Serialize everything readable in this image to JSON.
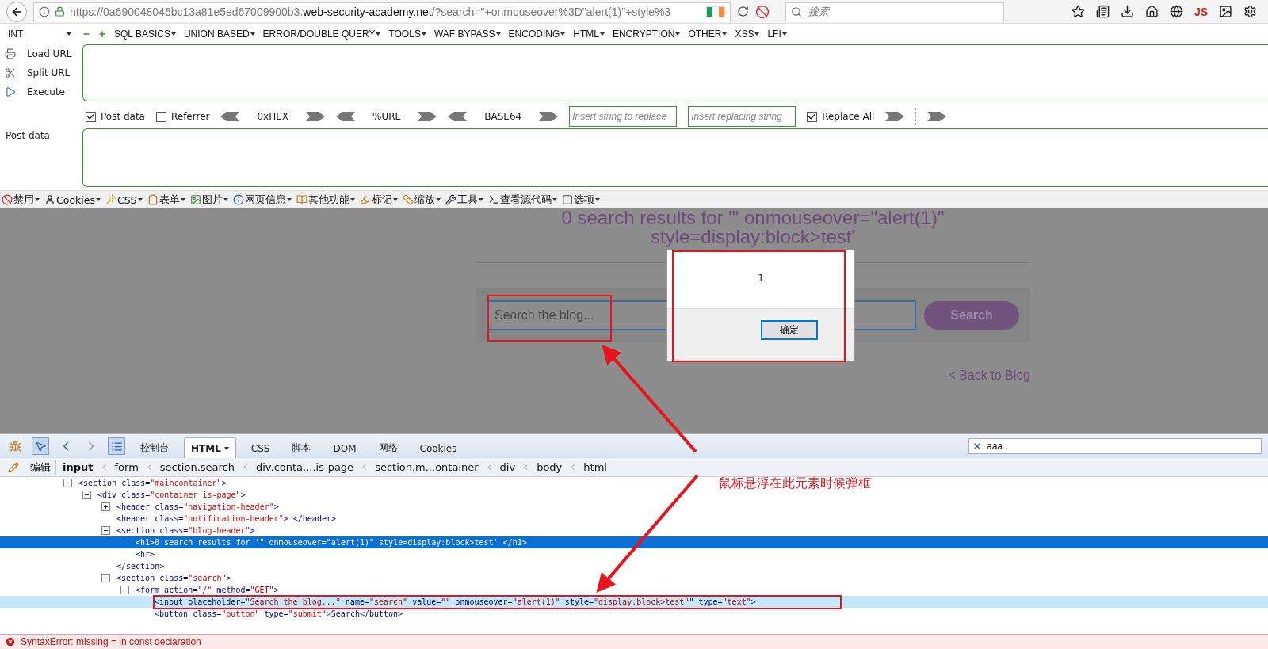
{
  "browser": {
    "url": {
      "prefix": "https://0a690048046bc13a81e5ed67009900b3.",
      "domain": "web-security-academy.net",
      "path": "/?search=\"+onmouseover%3D\"alert(1)\"+style%3"
    },
    "search": {
      "placeholder": "搜索"
    },
    "js_label": "JS"
  },
  "hackbar": {
    "select": "INT",
    "menus": [
      "SQL BASICS",
      "UNION BASED",
      "ERROR/DOUBLE QUERY",
      "TOOLS",
      "WAF BYPASS",
      "ENCODING",
      "HTML",
      "ENCRYPTION",
      "OTHER",
      "XSS",
      "LFI"
    ],
    "actions": [
      {
        "label": "Load URL",
        "kind": "load"
      },
      {
        "label": "Split URL",
        "kind": "split"
      },
      {
        "label": "Execute",
        "kind": "execute"
      }
    ],
    "options": [
      {
        "kind": "checkbox",
        "label": "Post data",
        "checked": true
      },
      {
        "kind": "checkbox",
        "label": "Referrer",
        "checked": false
      },
      {
        "kind": "encoder",
        "label": "0xHEX"
      },
      {
        "kind": "encoder",
        "label": "%URL"
      },
      {
        "kind": "encoder",
        "label": "BASE64"
      },
      {
        "kind": "field",
        "placeholder": "Insert string to replace"
      },
      {
        "kind": "field",
        "placeholder": "Insert replacing string"
      },
      {
        "kind": "checkbox",
        "label": "Replace All",
        "checked": true
      }
    ],
    "post_label": "Post data"
  },
  "webdev_toolbar": [
    "禁用",
    "Cookies",
    "CSS",
    "表单",
    "图片",
    "网页信息",
    "其他功能",
    "标记",
    "缩放",
    "工具",
    "查看源代码",
    "选项"
  ],
  "page": {
    "heading": "0 search results for '\" onmouseover=\"alert(1)\" style=display:block>test'",
    "search_placeholder": "Search the blog...",
    "search_button": "Search",
    "back_link": "< Back to Blog"
  },
  "alert": {
    "message": "1",
    "ok_button": "确定"
  },
  "annotation": "鼠标悬浮在此元素时候弹框",
  "devtools": {
    "tabs": [
      {
        "label": "控制台",
        "selected": false
      },
      {
        "label": "HTML",
        "selected": true
      },
      {
        "label": "CSS",
        "selected": false
      },
      {
        "label": "脚本",
        "selected": false
      },
      {
        "label": "DOM",
        "selected": false
      },
      {
        "label": "网络",
        "selected": false
      },
      {
        "label": "Cookies",
        "selected": false
      }
    ],
    "search_value": "aaa",
    "edit_label": "编辑",
    "breadcrumbs": [
      {
        "label": "input",
        "selected": true
      },
      {
        "label": "form",
        "selected": false
      },
      {
        "label": "section.search",
        "selected": false
      },
      {
        "label": "div.conta....is-page",
        "selected": false
      },
      {
        "label": "section.m...ontainer",
        "selected": false
      },
      {
        "label": "div",
        "selected": false
      },
      {
        "label": "body",
        "selected": false
      },
      {
        "label": "html",
        "selected": false
      }
    ],
    "tree": [
      {
        "text": "<section class=\"maincontainer\">",
        "expanded": true,
        "selected": false,
        "hovered": false,
        "children": [
          {
            "text": "<div class=\"container is-page\">",
            "expanded": true,
            "selected": false,
            "hovered": false,
            "children": [
              {
                "text": "<header class=\"navigation-header\">",
                "expanded": false,
                "selected": false,
                "hovered": false
              },
              {
                "text": "<header class=\"notification-header\"> </header>",
                "selected": false,
                "hovered": false
              },
              {
                "text": "<section class=\"blog-header\">",
                "expanded": true,
                "selected": false,
                "hovered": false,
                "close": "</section>",
                "children": [
                  {
                    "text": "<h1>0 search results for '\" onmouseover=\"alert(1)\" style=display:block>test' </h1>",
                    "selected": true,
                    "hovered": false
                  },
                  {
                    "text": "<hr>",
                    "selected": false,
                    "hovered": false
                  }
                ]
              },
              {
                "text": "<section class=\"search\">",
                "expanded": true,
                "selected": false,
                "hovered": false,
                "children": [
                  {
                    "text": "<form action=\"/\" method=\"GET\">",
                    "expanded": true,
                    "selected": false,
                    "hovered": false,
                    "children": [
                      {
                        "text": "<input placeholder=\"Search the blog...\" name=\"search\" value=\"\" onmouseover=\"alert(1)\" style=\"display:block>test\"\" type=\"text\">",
                        "selected": false,
                        "hovered": true
                      },
                      {
                        "text": "<button class=\"button\" type=\"submit\">Search</button>",
                        "selected": false,
                        "hovered": false
                      }
                    ]
                  }
                ]
              }
            ]
          }
        ]
      }
    ],
    "error": "SyntaxError: missing = in const declaration"
  }
}
